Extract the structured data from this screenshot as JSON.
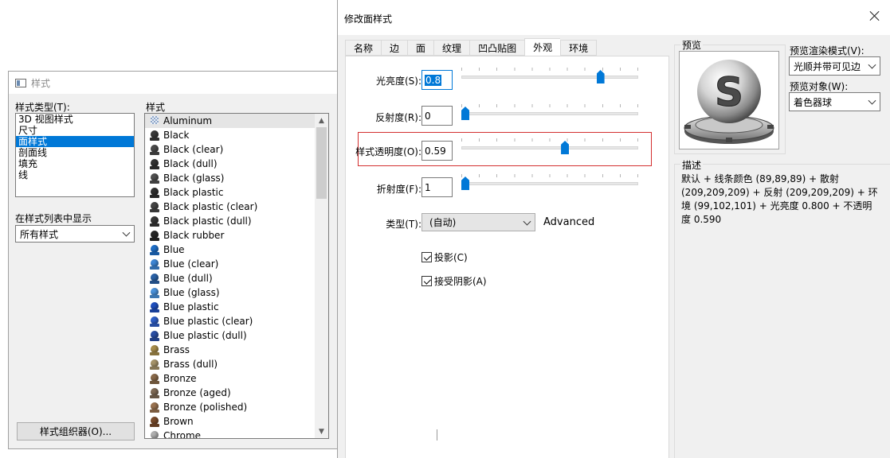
{
  "back_window": {
    "title": "样式",
    "style_types_label": "样式类型(T):",
    "style_types": [
      {
        "label": "3D 视图样式",
        "selected": false
      },
      {
        "label": "尺寸",
        "selected": false
      },
      {
        "label": "面样式",
        "selected": true
      },
      {
        "label": "剖面线",
        "selected": false
      },
      {
        "label": "填充",
        "selected": false
      },
      {
        "label": "线",
        "selected": false
      }
    ],
    "styles_label": "样式",
    "styles": [
      {
        "label": "Aluminum",
        "color": "#9fb3cf",
        "icon": "checker-swatch-icon",
        "selected": true
      },
      {
        "label": "Black",
        "color": "#3a3a3a"
      },
      {
        "label": "Black (clear)",
        "color": "#4a4a4a"
      },
      {
        "label": "Black (dull)",
        "color": "#333333"
      },
      {
        "label": "Black (glass)",
        "color": "#505050"
      },
      {
        "label": "Black plastic",
        "color": "#2f2f2f"
      },
      {
        "label": "Black plastic (clear)",
        "color": "#454545"
      },
      {
        "label": "Black plastic (dull)",
        "color": "#363636"
      },
      {
        "label": "Black rubber",
        "color": "#262626"
      },
      {
        "label": "Blue",
        "color": "#1e6fc9"
      },
      {
        "label": "Blue (clear)",
        "color": "#3d86d6"
      },
      {
        "label": "Blue (dull)",
        "color": "#2a62a8"
      },
      {
        "label": "Blue (glass)",
        "color": "#4b93dd"
      },
      {
        "label": "Blue plastic",
        "color": "#1f4fbf"
      },
      {
        "label": "Blue plastic (clear)",
        "color": "#2f5fc8"
      },
      {
        "label": "Blue plastic (dull)",
        "color": "#2b4fa5"
      },
      {
        "label": "Brass",
        "color": "#a88d4b"
      },
      {
        "label": "Brass (dull)",
        "color": "#a6946a"
      },
      {
        "label": "Bronze",
        "color": "#8a6a4a"
      },
      {
        "label": "Bronze (aged)",
        "color": "#7f6a55"
      },
      {
        "label": "Bronze (polished)",
        "color": "#9a7350"
      },
      {
        "label": "Brown",
        "color": "#7a4b2a"
      },
      {
        "label": "Chrome",
        "color": "#b0b0b0"
      }
    ],
    "show_in_list_label": "在样式列表中显示",
    "show_in_list_value": "所有样式",
    "organizer_button": "样式组织器(O)..."
  },
  "front_window": {
    "title": "修改面样式",
    "tabs": [
      {
        "label": "名称",
        "active": false
      },
      {
        "label": "边",
        "active": false
      },
      {
        "label": "面",
        "active": false
      },
      {
        "label": "纹理",
        "active": false
      },
      {
        "label": "凹凸贴图",
        "active": false
      },
      {
        "label": "外观",
        "active": true
      },
      {
        "label": "环境",
        "active": false
      }
    ],
    "fields": {
      "brightness": {
        "label": "光亮度(S):",
        "value": "0.8",
        "level": 0.8
      },
      "reflectivity": {
        "label": "反射度(R):",
        "value": "0",
        "level": 0
      },
      "transparency": {
        "label": "样式透明度(O):",
        "value": "0.59",
        "level": 0.59
      },
      "refraction": {
        "label": "折射度(F):",
        "value": "1",
        "level": 0
      }
    },
    "type_label": "类型(T):",
    "type_value": "(自动)",
    "advanced_label": "Advanced",
    "shadow_cast": {
      "label": "投影(C)",
      "checked": true
    },
    "shadow_receive": {
      "label": "接受阴影(A)",
      "checked": true
    },
    "preview": {
      "title": "预览",
      "render_mode_label": "预览渲染模式(V):",
      "render_mode_value": "光顺并带可见边",
      "object_label": "预览对象(W):",
      "object_value": "着色器球",
      "logo_letter": "S"
    },
    "description": {
      "title": "描述",
      "text": "默认 + 线条颜色 (89,89,89) + 散射 (209,209,209) + 反射 (209,209,209) + 环境 (99,102,101) + 光亮度 0.800 + 不透明度 0.590"
    }
  },
  "colors": {
    "accent": "#0078d7",
    "highlight_border": "#d32f2f",
    "dialog_bg": "#f0f0f0"
  }
}
